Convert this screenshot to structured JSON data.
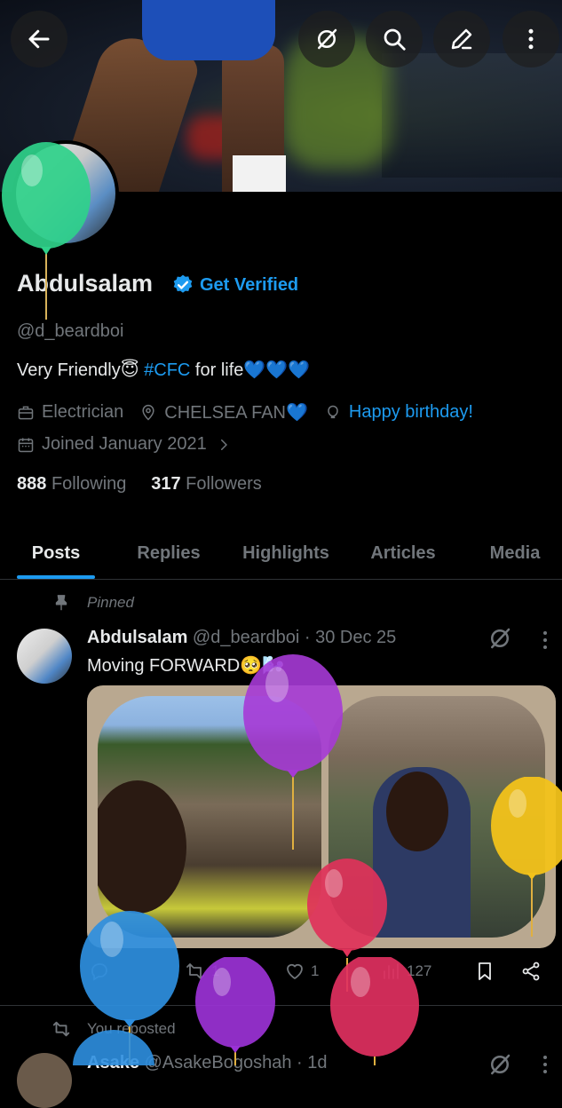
{
  "profile": {
    "name": "Abdulsalam",
    "get_verified": "Get Verified",
    "handle": "@d_beardboi",
    "bio_text_1": "Very Friendly😇 ",
    "bio_tag": "#CFC",
    "bio_text_2": " for life💙💙💙",
    "occupation": "Electrician",
    "location": "CHELSEA FAN💙",
    "birthday": "Happy birthday!",
    "joined": "Joined January 2021",
    "following_count": "888",
    "following_label": "Following",
    "followers_count": "317",
    "followers_label": "Followers"
  },
  "header_icons": [
    "back-arrow-icon",
    "grok-icon",
    "search-icon",
    "edit-icon",
    "more-vertical-icon"
  ],
  "tabs": [
    {
      "label": "Posts",
      "active": true
    },
    {
      "label": "Replies",
      "active": false
    },
    {
      "label": "Highlights",
      "active": false
    },
    {
      "label": "Articles",
      "active": false
    },
    {
      "label": "Media",
      "active": false
    }
  ],
  "pinned_post": {
    "pinned_label": "Pinned",
    "author": "Abdulsalam",
    "handle": "@d_beardboi",
    "date": "· 30 Dec 25",
    "text": "Moving FORWARD🥺🌬️",
    "replies": "",
    "reposts": "1",
    "likes": "1",
    "views": "127"
  },
  "reposted_post": {
    "reposted_label": "You reposted",
    "author": "Asake",
    "handle": "@AsakeBogoshah",
    "date": "· 1d"
  },
  "colors": {
    "accent": "#1d9bf0",
    "background": "#000000",
    "text_primary": "#e7e9ea",
    "text_secondary": "#71767b",
    "balloon_colors": [
      "#2fd18a",
      "#a63ad6",
      "#f2c21a",
      "#e0325a",
      "#2e8fe0",
      "#9b32d6",
      "#e03060"
    ]
  }
}
